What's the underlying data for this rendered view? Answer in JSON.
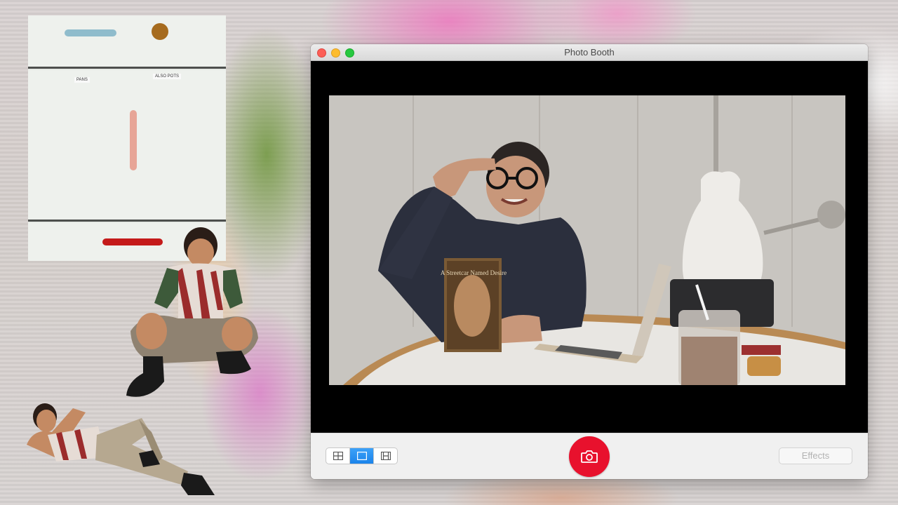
{
  "window": {
    "title": "Photo Booth",
    "traffic_lights": {
      "close_color": "#fc5f57",
      "minimize_color": "#fdbc2e",
      "zoom_color": "#27c840"
    }
  },
  "camera_feed": {
    "book_title_text": "A Streetcar Named Desire"
  },
  "toolbar": {
    "view_modes": [
      {
        "icon": "grid-four-icon",
        "selected": false
      },
      {
        "icon": "single-photo-icon",
        "selected": true
      },
      {
        "icon": "filmstrip-icon",
        "selected": false
      }
    ],
    "shutter_icon": "camera-icon",
    "shutter_color": "#e8112d",
    "effects_label": "Effects"
  },
  "background": {
    "drawer_labels": [
      "PANS",
      "ALSO POTS"
    ]
  },
  "colors": {
    "accent_blue": "#1b84ea",
    "viewport_bg": "#000000"
  }
}
